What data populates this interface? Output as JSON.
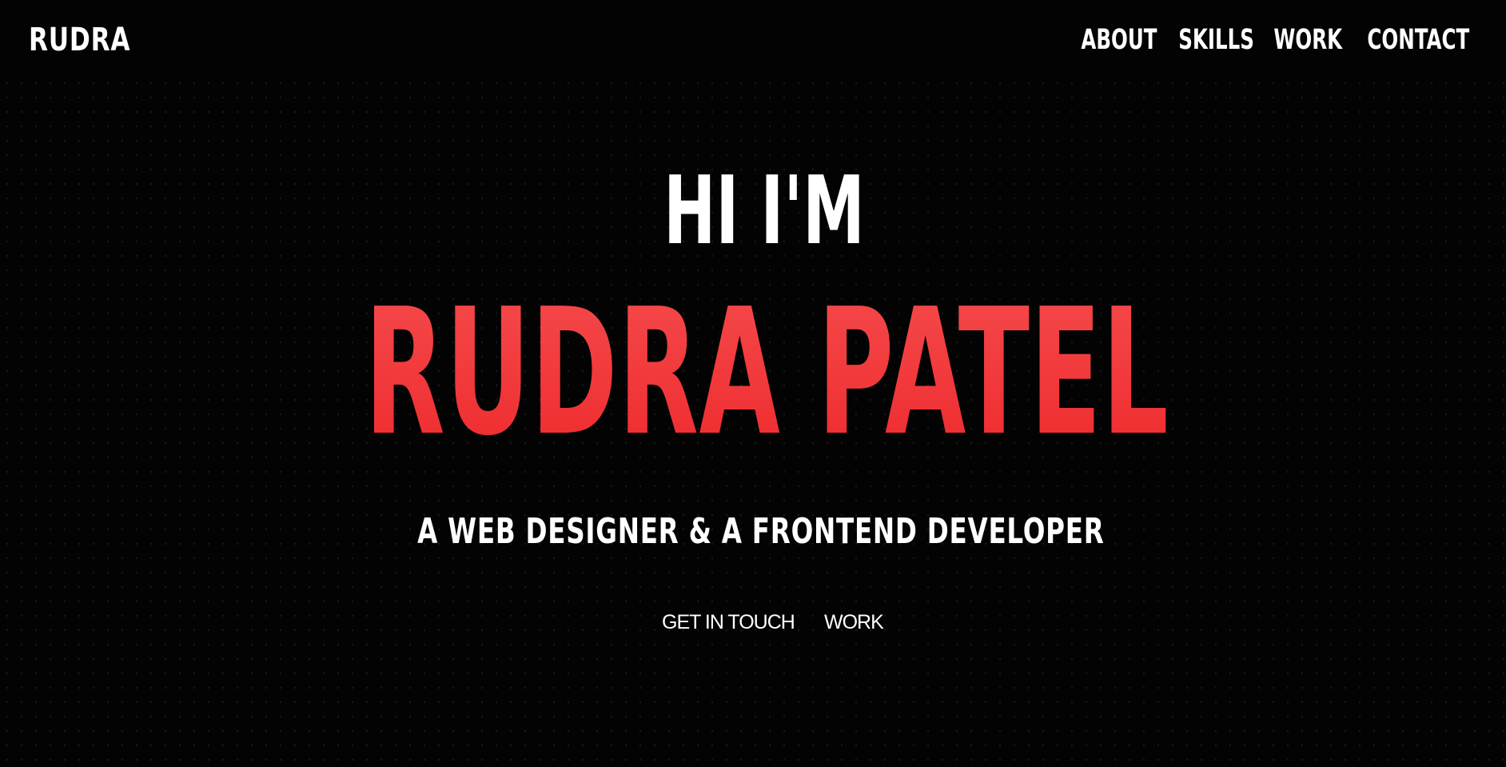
{
  "header": {
    "logo": "RUDRA",
    "nav": [
      "ABOUT",
      "SKILLS",
      "WORK",
      "CONTACT"
    ]
  },
  "hero": {
    "greeting": "HI I'M",
    "name": "RUDRA PATEL",
    "tagline": "A WEB DESIGNER & A FRONTEND DEVELOPER",
    "buttons": {
      "get_in_touch": "GET IN TOUCH",
      "work": "WORK"
    }
  },
  "colors": {
    "background": "#030303",
    "accent": "#f43a3d",
    "text": "#ffffff"
  }
}
